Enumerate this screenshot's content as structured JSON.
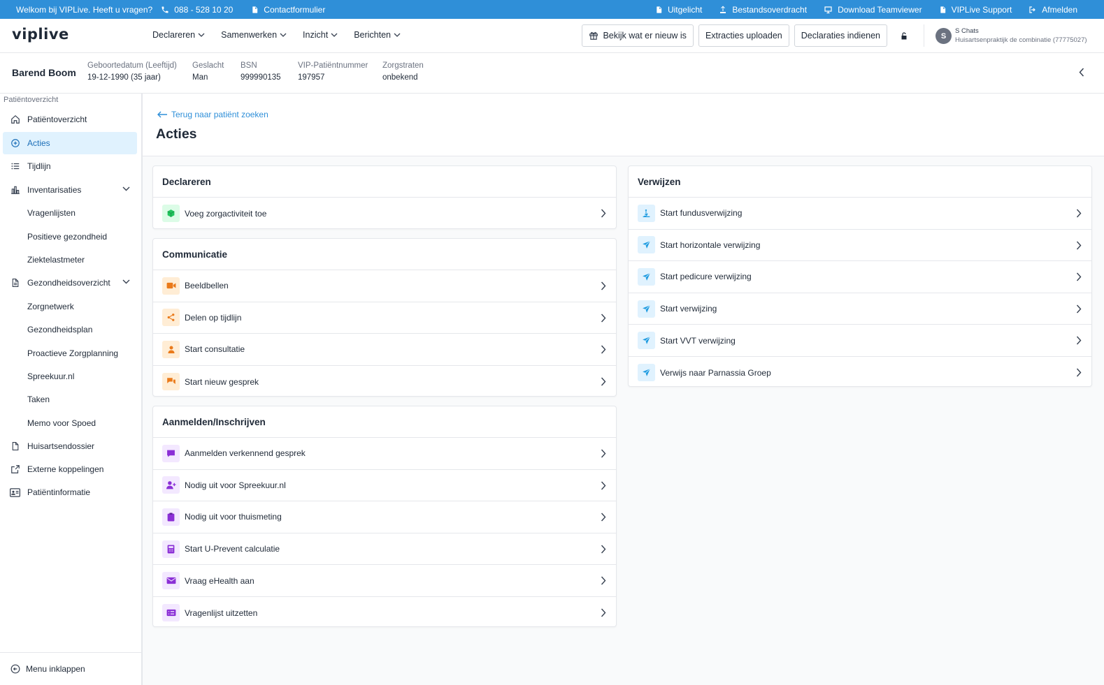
{
  "topbar": {
    "welcome": "Welkom bij VIPLive. Heeft u vragen?",
    "phone": "088 - 528 10 20",
    "contact": "Contactformulier",
    "links": [
      "Uitgelicht",
      "Bestandsoverdracht",
      "Download Teamviewer",
      "VIPLive Support",
      "Afmelden"
    ]
  },
  "header": {
    "logo": "viplive",
    "nav": [
      "Declareren",
      "Samenwerken",
      "Inzicht",
      "Berichten"
    ],
    "buttons": {
      "whats_new": "Bekijk wat er nieuw is",
      "extractions": "Extracties uploaden",
      "declarations": "Declaraties indienen"
    },
    "user": {
      "initial": "S",
      "name": "S Chats",
      "org": "Huisartsenpraktijk de combinatie (77775027)"
    }
  },
  "patient": {
    "name": "Barend Boom",
    "fields": [
      {
        "label": "Geboortedatum (Leeftijd)",
        "value": "19-12-1990 (35 jaar)"
      },
      {
        "label": "Geslacht",
        "value": "Man"
      },
      {
        "label": "BSN",
        "value": "999990135"
      },
      {
        "label": "VIP-Patiëntnummer",
        "value": "197957"
      },
      {
        "label": "Zorgstraten",
        "value": "onbekend"
      }
    ]
  },
  "sidebar": {
    "title": "Patiëntoverzicht",
    "items": [
      {
        "label": "Patiëntoverzicht"
      },
      {
        "label": "Acties"
      },
      {
        "label": "Tijdlijn"
      },
      {
        "label": "Inventarisaties"
      },
      {
        "label": "Vragenlijsten"
      },
      {
        "label": "Positieve gezondheid"
      },
      {
        "label": "Ziektelastmeter"
      },
      {
        "label": "Gezondheidsoverzicht"
      },
      {
        "label": "Zorgnetwerk"
      },
      {
        "label": "Gezondheidsplan"
      },
      {
        "label": "Proactieve Zorgplanning"
      },
      {
        "label": "Spreekuur.nl"
      },
      {
        "label": "Taken"
      },
      {
        "label": "Memo voor Spoed"
      },
      {
        "label": "Huisartsendossier"
      },
      {
        "label": "Externe koppelingen"
      },
      {
        "label": "Patiëntinformatie"
      }
    ],
    "footer": "Menu inklappen"
  },
  "main": {
    "back": "Terug naar patiënt zoeken",
    "title": "Acties",
    "cards": {
      "declareren": {
        "title": "Declareren",
        "rows": [
          "Voeg zorgactiviteit toe"
        ]
      },
      "communicatie": {
        "title": "Communicatie",
        "rows": [
          "Beeldbellen",
          "Delen op tijdlijn",
          "Start consultatie",
          "Start nieuw gesprek"
        ]
      },
      "aanmelden": {
        "title": "Aanmelden/Inschrijven",
        "rows": [
          "Aanmelden verkennend gesprek",
          "Nodig uit voor Spreekuur.nl",
          "Nodig uit voor thuismeting",
          "Start U-Prevent calculatie",
          "Vraag eHealth aan",
          "Vragenlijst uitzetten"
        ]
      },
      "verwijzen": {
        "title": "Verwijzen",
        "rows": [
          "Start fundusverwijzing",
          "Start horizontale verwijzing",
          "Start pedicure verwijzing",
          "Start verwijzing",
          "Start VVT verwijzing",
          "Verwijs naar Parnassia Groep"
        ]
      }
    }
  },
  "colors": {
    "topbar": "#2f8fd8",
    "active_bg": "#e0f2fe",
    "green": "#22c55e",
    "orange": "#ea7a1a",
    "purple": "#8b2fd6",
    "blue": "#1e9be0"
  }
}
